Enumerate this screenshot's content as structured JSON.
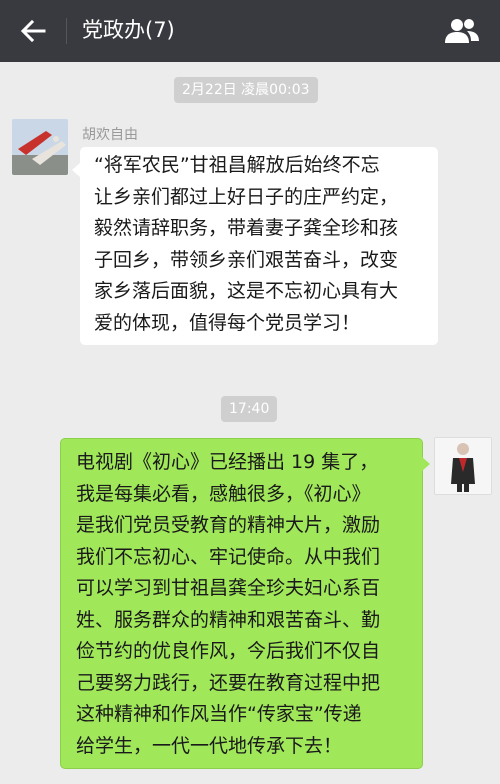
{
  "header": {
    "title": "党政办(7)",
    "back_icon": "arrow-left-icon",
    "group_icon": "group-members-icon"
  },
  "messages": [
    {
      "timestamp": "2月22日 凌晨00:03",
      "sender": "胡欢自由",
      "direction": "incoming",
      "text": "“将军农民”甘祖昌解放后始终不忘\n让乡亲们都过上好日子的庄严约定，\n毅然请辞职务，带着妻子龚全珍和孩\n子回乡，带领乡亲们艰苦奋斗，改变\n家乡落后面貌，这是不忘初心具有大\n爱的体现，值得每个党员学习！"
    },
    {
      "timestamp": "17:40",
      "direction": "outgoing",
      "text": "电视剧《初心》已经播出 19 集了，\n我是每集必看，感触很多，《初心》\n是我们党员受教育的精神大片，激励\n我们不忘初心、牢记使命。从中我们\n可以学习到甘祖昌龚全珍夫妇心系百\n姓、服务群众的精神和艰苦奋斗、勤\n俭节约的优良作风，今后我们不仅自\n己要努力践行，还要在教育过程中把\n这种精神和作风当作“传家宝”传递\n给学生，一代一代地传承下去！"
    }
  ],
  "colors": {
    "topbar": "#393a3f",
    "background": "#ececec",
    "outgoing_bubble": "#a0e75a",
    "incoming_bubble": "#ffffff",
    "timestamp_bg": "#cfcfcf"
  }
}
